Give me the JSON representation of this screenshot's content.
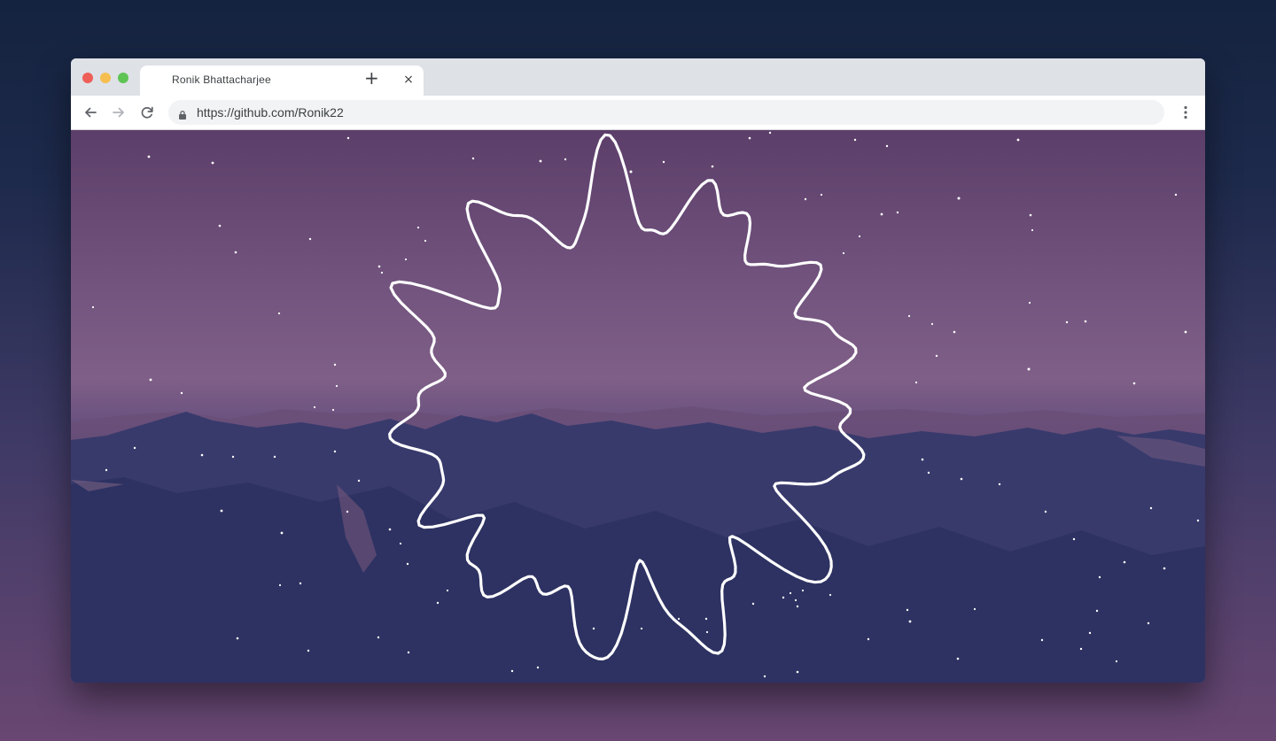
{
  "browser": {
    "tab": {
      "title": "Ronik Bhattacharjee",
      "close_label": "×"
    },
    "new_tab_label": "+",
    "address_bar": {
      "url": "https://github.com/Ronik22"
    }
  },
  "icons": {
    "back": "arrow-left-icon",
    "forward": "arrow-right-icon",
    "reload": "reload-icon",
    "lock": "lock-icon",
    "menu": "vertical-dots-icon"
  },
  "page": {
    "background": "night-sky-mountains",
    "visualizer": "circular-audio-waveform",
    "colors": {
      "sky_top": "#5c3e6a",
      "sky_mid": "#7f5f87",
      "mountains": "#2e3564",
      "waveform": "#ffffff"
    }
  }
}
